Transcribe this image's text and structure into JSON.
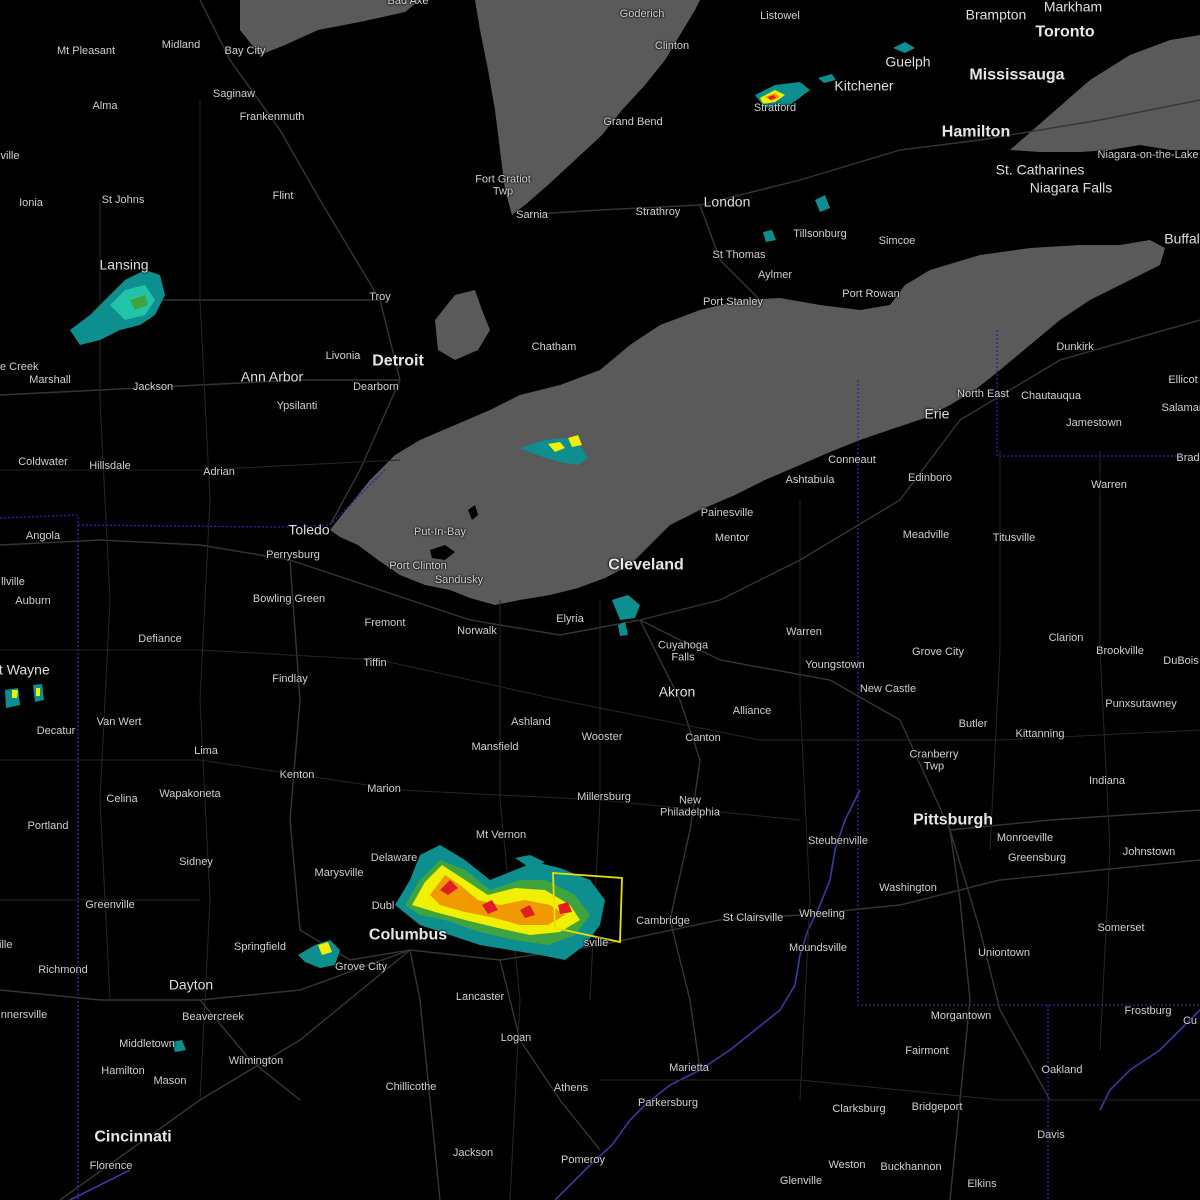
{
  "map": {
    "colors": {
      "background": "#000000",
      "water": "#5a5a5a",
      "roads": "#3a3a3a",
      "state_border": "#2626a8",
      "river": "#3a3aa0",
      "warning_polygon": "#e8e000",
      "radar_light": "#0e8f8f",
      "radar_mid": "#22c3a8",
      "radar_green": "#3fa43f",
      "radar_yellow": "#f0f000",
      "radar_orange": "#f09a00",
      "radar_red": "#e02020"
    },
    "labels": {
      "bad_axe": "Bad Axe",
      "goderich": "Goderich",
      "listowel": "Listowel",
      "brampton": "Brampton",
      "markham": "Markham",
      "toronto": "Toronto",
      "mt_pleasant": "Mt Pleasant",
      "midland": "Midland",
      "bay_city": "Bay City",
      "clinton": "Clinton",
      "guelph": "Guelph",
      "kitchener": "Kitchener",
      "mississauga": "Mississauga",
      "alma": "Alma",
      "saginaw": "Saginaw",
      "frankenmuth": "Frankenmuth",
      "stratford": "Stratford",
      "grand_bend": "Grand Bend",
      "hamilton_on": "Hamilton",
      "niagara_on_the_lake": "Niagara-on-the-Lake",
      "st_catharines": "St. Catharines",
      "niagara_falls": "Niagara Falls",
      "ville_left": "ville",
      "fort_gratiot": "Fort Gratiot\nTwp",
      "flint": "Flint",
      "ionia": "Ionia",
      "st_johns": "St Johns",
      "sarnia": "Sarnia",
      "strathroy": "Strathroy",
      "london": "London",
      "tillsonburg": "Tillsonburg",
      "simcoe": "Simcoe",
      "buffalo": "Buffal",
      "lansing": "Lansing",
      "st_thomas": "St Thomas",
      "aylmer": "Aylmer",
      "troy": "Troy",
      "port_rowan": "Port Rowan",
      "port_stanley": "Port Stanley",
      "chatham": "Chatham",
      "livonia": "Livonia",
      "detroit": "Detroit",
      "dunkirk": "Dunkirk",
      "le_creek": "le Creek",
      "marshall": "Marshall",
      "ann_arbor": "Ann Arbor",
      "dearborn": "Dearborn",
      "jackson_mi": "Jackson",
      "ypsilanti": "Ypsilanti",
      "ellicott": "Ellicot",
      "north_east": "North East",
      "chautauqua": "Chautauqua",
      "erie": "Erie",
      "salamanca": "Salamar",
      "jamestown": "Jamestown",
      "coldwater": "Coldwater",
      "hillsdale": "Hillsdale",
      "adrian": "Adrian",
      "bradford": "Brad",
      "conneaut": "Conneaut",
      "ashtabula": "Ashtabula",
      "edinboro": "Edinboro",
      "warren_pa": "Warren",
      "painesville": "Painesville",
      "toledo": "Toledo",
      "put_in_bay": "Put-In-Bay",
      "angola": "Angola",
      "mentor": "Mentor",
      "meadville": "Meadville",
      "titusville": "Titusville",
      "perrysburg": "Perrysburg",
      "cleveland": "Cleveland",
      "port_clinton": "Port Clinton",
      "sandusky": "Sandusky",
      "ville_left2": "llville",
      "auburn": "Auburn",
      "bowling_green": "Bowling Green",
      "elyria": "Elyria",
      "fremont": "Fremont",
      "norwalk": "Norwalk",
      "warren_oh": "Warren",
      "defiance": "Defiance",
      "clarion": "Clarion",
      "cuyahoga_falls": "Cuyahoga\nFalls",
      "grove_city_pa": "Grove City",
      "brookville": "Brookville",
      "dubois": "DuBois",
      "tiffin": "Tiffin",
      "youngstown": "Youngstown",
      "fort_wayne": "rt Wayne",
      "findlay": "Findlay",
      "akron": "Akron",
      "new_castle": "New Castle",
      "punxsutawney": "Punxsutawney",
      "alliance": "Alliance",
      "ashland": "Ashland",
      "van_wert": "Van Wert",
      "butler": "Butler",
      "decatur": "Decatur",
      "kittanning": "Kittanning",
      "mansfield": "Mansfield",
      "wooster": "Wooster",
      "canton": "Canton",
      "lima": "Lima",
      "cranberry": "Cranberry\nTwp",
      "kenton": "Kenton",
      "indiana": "Indiana",
      "marion": "Marion",
      "celina": "Celina",
      "wapakoneta": "Wapakoneta",
      "millersburg": "Millersburg",
      "new_philadelphia": "New\nPhiladelphia",
      "portland": "Portland",
      "steubenville": "Steubenville",
      "pittsburgh": "Pittsburgh",
      "monroeville": "Monroeville",
      "mt_vernon": "Mt Vernon",
      "johnstown": "Johnstown",
      "greensburg": "Greensburg",
      "sidney": "Sidney",
      "delaware": "Delaware",
      "marysville": "Marysville",
      "washington": "Washington",
      "greenville": "Greenville",
      "cambridge": "Cambridge",
      "st_clairsville": "St Clairsville",
      "wheeling": "Wheeling",
      "dublin": "Dubl",
      "somerset": "Somerset",
      "columbus": "Columbus",
      "zanesville": "sville",
      "springfield": "Springfield",
      "moundsville": "Moundsville",
      "uniontown": "Uniontown",
      "richmond": "Richmond",
      "grove_city_oh": "Grove City",
      "dayton": "Dayton",
      "lancaster": "Lancaster",
      "beavercreek": "Beavercreek",
      "connersville": "nnersville",
      "morgantown": "Morgantown",
      "frostburg": "Frostburg",
      "cumberland": "Cu",
      "middletown": "Middletown",
      "logan": "Logan",
      "fairmont": "Fairmont",
      "wilmington": "Wilmington",
      "oakland": "Oakland",
      "marietta": "Marietta",
      "hamilton_oh": "Hamilton",
      "mason": "Mason",
      "chillicothe": "Chillicothe",
      "athens": "Athens",
      "parkersburg": "Parkersburg",
      "clarksburg": "Clarksburg",
      "bridgeport": "Bridgeport",
      "cincinnati": "Cincinnati",
      "davis": "Davis",
      "florence": "Florence",
      "jackson_oh": "Jackson",
      "pomeroy": "Pomeroy",
      "weston": "Weston",
      "buckhannon": "Buckhannon",
      "glenville": "Glenville",
      "elkins": "Elkins",
      "ville_edge": "ville"
    }
  }
}
